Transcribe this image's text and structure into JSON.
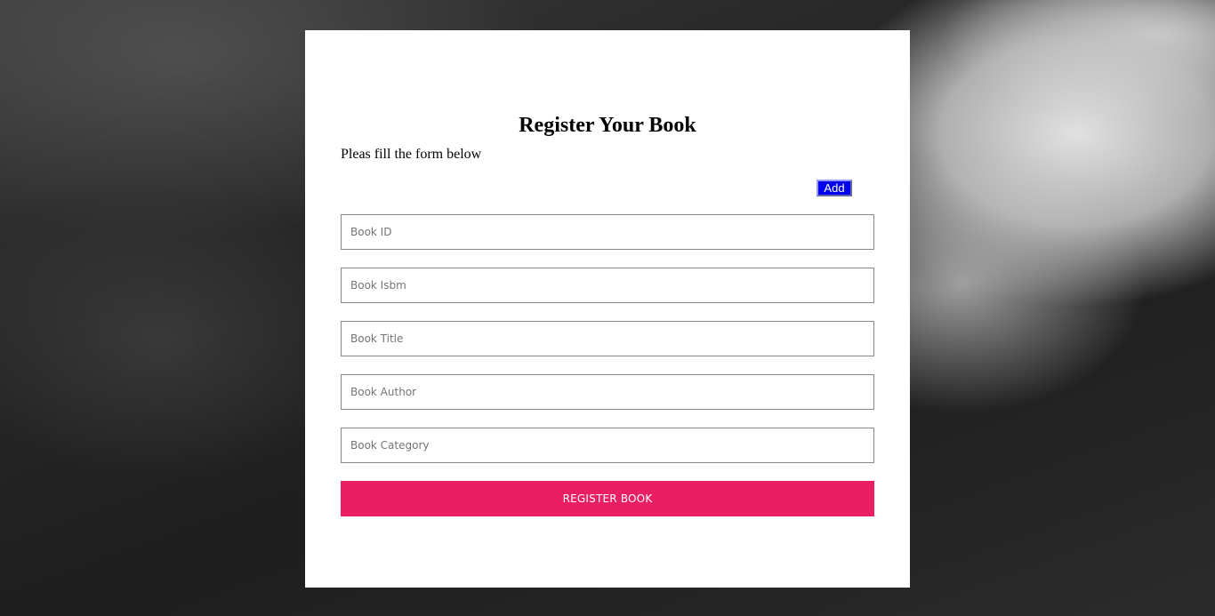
{
  "form": {
    "title": "Register Your Book",
    "subtitle": "Pleas fill the form below",
    "add_label": "Add",
    "fields": [
      {
        "placeholder": "Book ID",
        "value": ""
      },
      {
        "placeholder": "Book Isbm",
        "value": ""
      },
      {
        "placeholder": "Book Title",
        "value": ""
      },
      {
        "placeholder": "Book Author",
        "value": ""
      },
      {
        "placeholder": "Book Category",
        "value": ""
      }
    ],
    "submit_label": "REGISTER BOOK"
  },
  "colors": {
    "submit_button": "#e91e63",
    "add_button": "#0000ee",
    "card": "#ffffff"
  }
}
